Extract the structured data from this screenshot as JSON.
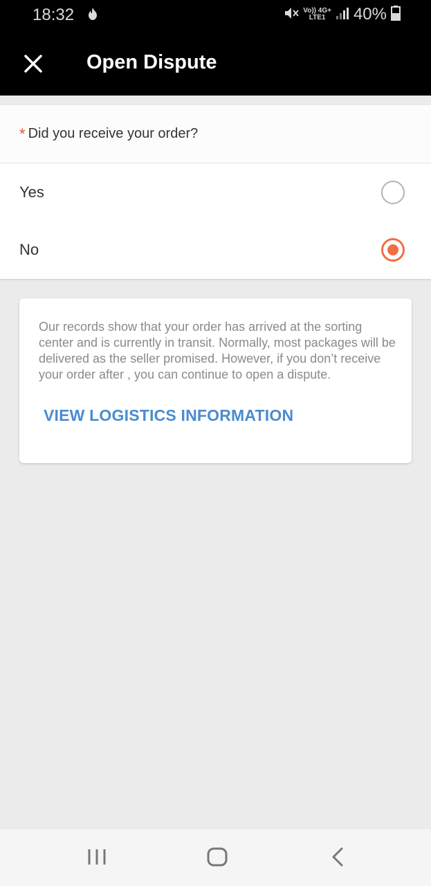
{
  "status_bar": {
    "time": "18:32",
    "network_top": "Vo)) 4G+",
    "network_bottom": "LTE1",
    "battery_percent": "40%"
  },
  "app_bar": {
    "title": "Open Dispute"
  },
  "question": {
    "required_mark": "*",
    "text": "Did you receive your order?",
    "options": [
      {
        "label": "Yes",
        "selected": false
      },
      {
        "label": "No",
        "selected": true
      }
    ]
  },
  "info": {
    "message": "Our records show that your order has arrived at the sorting center and is currently in transit.  Normally, most packages will be delivered as the seller promised. However, if you don’t receive your order after , you can continue to open a dispute.",
    "link_label": "VIEW LOGISTICS INFORMATION"
  },
  "colors": {
    "accent": "#f26d43",
    "link": "#4a8ccf",
    "required": "#e8542a"
  }
}
